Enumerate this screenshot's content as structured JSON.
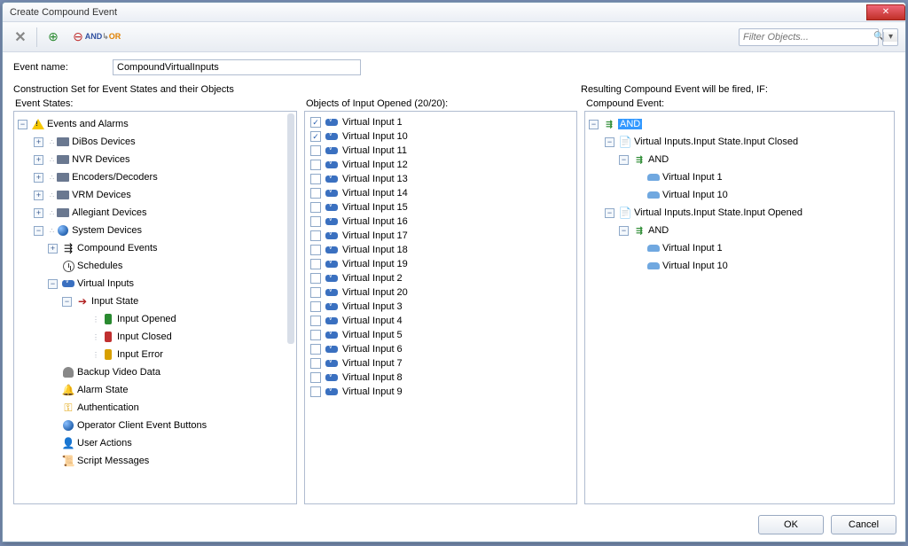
{
  "window": {
    "title": "Create Compound Event"
  },
  "toolbar": {
    "filter_placeholder": "Filter Objects..."
  },
  "form": {
    "event_name_label": "Event name:",
    "event_name_value": "CompoundVirtualInputs"
  },
  "sections": {
    "construction_heading": "Construction Set for Event States and their Objects",
    "resulting_heading": "Resulting Compound Event will be fired, IF:",
    "event_states_heading": "Event States:",
    "objects_heading": "Objects of Input Opened (20/20):",
    "compound_heading": "Compound Event:"
  },
  "event_tree": {
    "root": "Events and Alarms",
    "items": [
      "DiBos Devices",
      "NVR Devices",
      "Encoders/Decoders",
      "VRM Devices",
      "Allegiant Devices"
    ],
    "system": {
      "label": "System Devices",
      "children": {
        "compound": "Compound Events",
        "schedules": "Schedules",
        "vinputs": {
          "label": "Virtual Inputs",
          "state": {
            "label": "Input State",
            "opened": "Input Opened",
            "closed": "Input Closed",
            "error": "Input Error"
          }
        },
        "backup": "Backup Video Data",
        "alarm": "Alarm State",
        "auth": "Authentication",
        "ocbtn": "Operator Client Event Buttons",
        "user": "User Actions",
        "script": "Script Messages"
      }
    }
  },
  "objects": [
    {
      "label": "Virtual Input 1",
      "checked": true
    },
    {
      "label": "Virtual Input 10",
      "checked": true
    },
    {
      "label": "Virtual Input 11",
      "checked": false
    },
    {
      "label": "Virtual Input 12",
      "checked": false
    },
    {
      "label": "Virtual Input 13",
      "checked": false
    },
    {
      "label": "Virtual Input 14",
      "checked": false
    },
    {
      "label": "Virtual Input 15",
      "checked": false
    },
    {
      "label": "Virtual Input 16",
      "checked": false
    },
    {
      "label": "Virtual Input 17",
      "checked": false
    },
    {
      "label": "Virtual Input 18",
      "checked": false
    },
    {
      "label": "Virtual Input 19",
      "checked": false
    },
    {
      "label": "Virtual Input 2",
      "checked": false
    },
    {
      "label": "Virtual Input 20",
      "checked": false
    },
    {
      "label": "Virtual Input 3",
      "checked": false
    },
    {
      "label": "Virtual Input 4",
      "checked": false
    },
    {
      "label": "Virtual Input 5",
      "checked": false
    },
    {
      "label": "Virtual Input 6",
      "checked": false
    },
    {
      "label": "Virtual Input 7",
      "checked": false
    },
    {
      "label": "Virtual Input 8",
      "checked": false
    },
    {
      "label": "Virtual Input 9",
      "checked": false
    }
  ],
  "result_tree": {
    "root": "AND",
    "closed_label": "Virtual Inputs.Input State.Input Closed",
    "opened_label": "Virtual Inputs.Input State.Input Opened",
    "and_label": "AND",
    "vi1": "Virtual Input 1",
    "vi10": "Virtual Input 10"
  },
  "footer": {
    "ok": "OK",
    "cancel": "Cancel"
  }
}
